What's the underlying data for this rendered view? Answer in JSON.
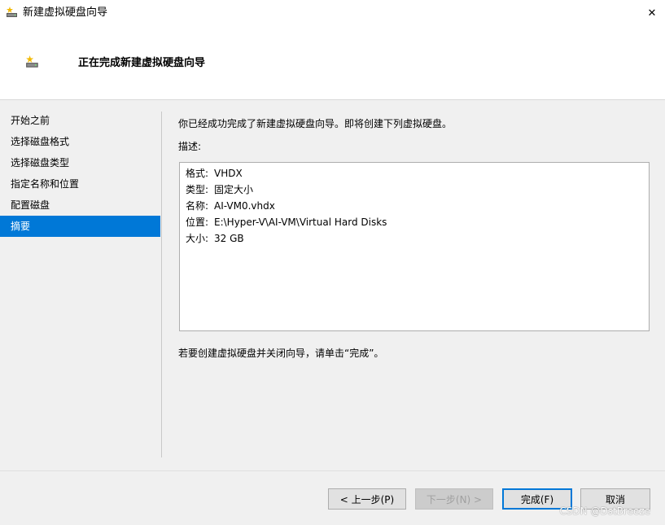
{
  "window": {
    "title": "新建虚拟硬盘向导",
    "close_glyph": "✕"
  },
  "header": {
    "title": "正在完成新建虚拟硬盘向导"
  },
  "nav": {
    "items": [
      "开始之前",
      "选择磁盘格式",
      "选择磁盘类型",
      "指定名称和位置",
      "配置磁盘",
      "摘要"
    ],
    "active_index": 5
  },
  "content": {
    "intro": "你已经成功完成了新建虚拟硬盘向导。即将创建下列虚拟硬盘。",
    "desc_label": "描述:",
    "details": [
      {
        "key": "格式:",
        "value": "VHDX"
      },
      {
        "key": "类型:",
        "value": "固定大小"
      },
      {
        "key": "名称:",
        "value": "AI-VM0.vhdx"
      },
      {
        "key": "位置:",
        "value": "E:\\Hyper-V\\AI-VM\\Virtual Hard Disks"
      },
      {
        "key": "大小:",
        "value": "32 GB"
      }
    ],
    "finish_hint": "若要创建虚拟硬盘并关闭向导，请单击“完成”。"
  },
  "buttons": {
    "prev": "< 上一步(P)",
    "next": "下一步(N) >",
    "finish": "完成(F)",
    "cancel": "取消"
  },
  "watermark": "CSDN @DstBreeze",
  "colors": {
    "accent": "#0078d7"
  },
  "icons": {
    "title": "disk-wizard-icon",
    "header": "disk-wizard-icon"
  }
}
